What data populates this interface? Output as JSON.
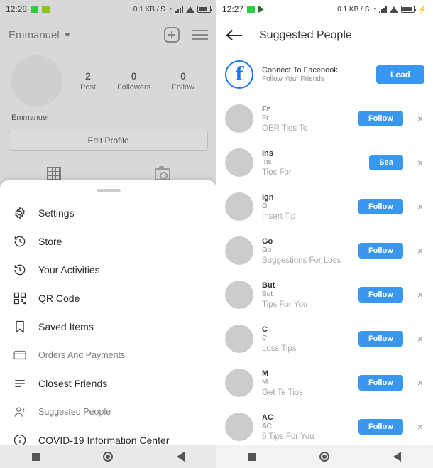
{
  "left_screen": {
    "statusbar": {
      "time": "12:28",
      "icons_left": [
        "green-square-icon",
        "photo-icon"
      ],
      "data_rate": "0.1 KB / S",
      "icons_right": [
        "clock-icon",
        "signal-bars-icon",
        "wifi-icon",
        "battery-icon"
      ]
    },
    "header": {
      "username": "Emmanuel",
      "chevron": "chevron-down-icon",
      "add_icon": "plus-box-icon",
      "menu_icon": "hamburger-icon"
    },
    "profile": {
      "avatar": "profile-avatar",
      "stats": [
        {
          "num": "2",
          "label": "Post"
        },
        {
          "num": "0",
          "label": "Followers"
        },
        {
          "num": "0",
          "label": "Follow"
        }
      ],
      "display_name": "Emmanuel",
      "edit_button": "Edit Profile",
      "tabs": [
        "grid-icon",
        "camera-icon"
      ]
    },
    "sheet": {
      "items": [
        {
          "label": "Settings",
          "icon": "gear-icon",
          "faded": false
        },
        {
          "label": "Store",
          "icon": "clock-history-icon",
          "faded": false
        },
        {
          "label": "Your Activities",
          "icon": "clock-history-icon",
          "faded": false
        },
        {
          "label": "QR Code",
          "icon": "qr-code-icon",
          "faded": false
        },
        {
          "label": "Saved Items",
          "icon": "bookmark-icon",
          "faded": false
        },
        {
          "label": "Orders And Payments",
          "icon": "card-icon",
          "faded": true
        },
        {
          "label": "Closest Friends",
          "icon": "list-icon",
          "faded": false
        },
        {
          "label": "Suggested People",
          "icon": "person-plus-icon",
          "faded": true
        },
        {
          "label": "COVID-19 Information Center",
          "icon": "info-circle-icon",
          "faded": false
        }
      ]
    },
    "navbar": [
      "square-icon",
      "circle-icon",
      "back-triangle-icon"
    ]
  },
  "right_screen": {
    "statusbar": {
      "time": "12:27",
      "icons_left": [
        "green-square-icon",
        "flag-icon"
      ],
      "data_rate": "0.1 KB / S",
      "icons_right": [
        "clock-icon",
        "signal-bars-icon",
        "wifi-icon",
        "battery-icon",
        "charging-bolt-icon"
      ]
    },
    "header": {
      "back_icon": "back-arrow-icon",
      "title": "Suggested People"
    },
    "facebook_row": {
      "avatar": "facebook-icon",
      "title": "Connect To Facebook",
      "subtitle": "Follow Your Friends",
      "button": "Lead"
    },
    "people": [
      {
        "name": "Fr",
        "handle": "Fr",
        "meta": "OER Tios To",
        "button": "Follow",
        "close": "×"
      },
      {
        "name": "Ins",
        "handle": "Ins",
        "meta": "Tios For",
        "button": "Sea",
        "close": "×"
      },
      {
        "name": "Ign",
        "handle": "G",
        "meta": "Insert Tip",
        "button": "Follow",
        "close": "×"
      },
      {
        "name": "Go",
        "handle": "Go",
        "meta": "Suggestions For Loss",
        "button": "Follow",
        "close": "×"
      },
      {
        "name": "But",
        "handle": "But",
        "meta": "Tips For You",
        "button": "Follow",
        "close": "×"
      },
      {
        "name": "C",
        "handle": "C",
        "meta": "Loss Tips",
        "button": "Follow",
        "close": "×"
      },
      {
        "name": "M",
        "handle": "M",
        "meta": "Get Te Tios",
        "button": "Follow",
        "close": "×"
      },
      {
        "name": "AC",
        "handle": "AC",
        "meta": "5 Tips For You",
        "button": "Follow",
        "close": "×"
      }
    ],
    "navbar": [
      "square-icon",
      "circle-icon",
      "back-triangle-icon"
    ]
  }
}
